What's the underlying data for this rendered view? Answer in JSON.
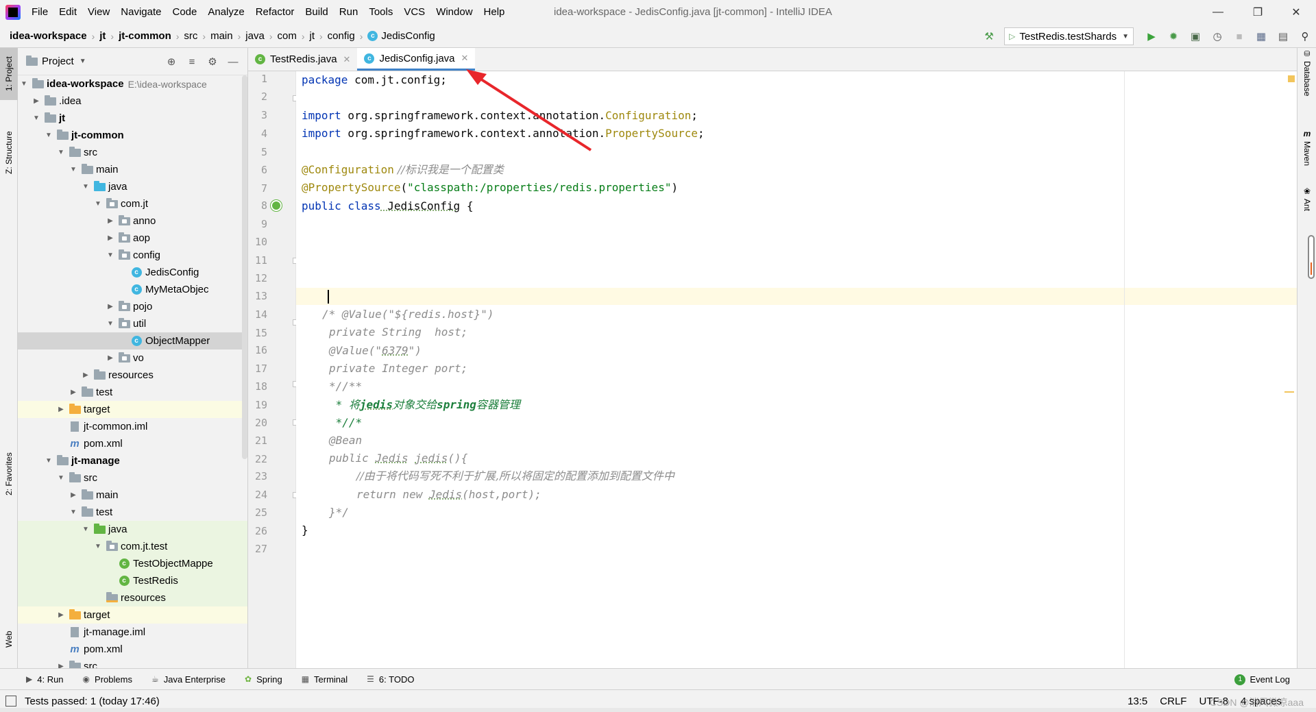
{
  "window": {
    "title": "idea-workspace - JedisConfig.java [jt-common] - IntelliJ IDEA",
    "menu": [
      "File",
      "Edit",
      "View",
      "Navigate",
      "Code",
      "Analyze",
      "Refactor",
      "Build",
      "Run",
      "Tools",
      "VCS",
      "Window",
      "Help"
    ]
  },
  "breadcrumb": [
    "idea-workspace",
    "jt",
    "jt-common",
    "src",
    "main",
    "java",
    "com",
    "jt",
    "config",
    "JedisConfig"
  ],
  "toolbar": {
    "run_config": "TestRedis.testShards",
    "icons": [
      "hammer-icon",
      "run-icon",
      "debug-icon",
      "coverage-icon",
      "profile-icon",
      "stop-icon",
      "project-structure-icon",
      "layout-icon",
      "search-icon"
    ]
  },
  "left_stripe": {
    "project": "1: Project",
    "structure": "Z: Structure",
    "favorites": "2: Favorites",
    "web": "Web"
  },
  "right_stripe": {
    "database": "Database",
    "maven": "Maven",
    "ant": "Ant"
  },
  "project_panel": {
    "title": "Project",
    "tree": [
      {
        "label": "idea-workspace",
        "path": "E:\\idea-workspace",
        "bold": true
      },
      {
        "label": ".idea"
      },
      {
        "label": "jt",
        "bold": true
      },
      {
        "label": "jt-common",
        "bold": true
      },
      {
        "label": "src"
      },
      {
        "label": "main"
      },
      {
        "label": "java"
      },
      {
        "label": "com.jt"
      },
      {
        "label": "anno"
      },
      {
        "label": "aop"
      },
      {
        "label": "config"
      },
      {
        "label": "JedisConfig"
      },
      {
        "label": "MyMetaObjec"
      },
      {
        "label": "pojo"
      },
      {
        "label": "util"
      },
      {
        "label": "ObjectMapper"
      },
      {
        "label": "vo"
      },
      {
        "label": "resources"
      },
      {
        "label": "test"
      },
      {
        "label": "target"
      },
      {
        "label": "jt-common.iml"
      },
      {
        "label": "pom.xml"
      },
      {
        "label": "jt-manage",
        "bold": true
      },
      {
        "label": "src"
      },
      {
        "label": "main"
      },
      {
        "label": "test"
      },
      {
        "label": "java"
      },
      {
        "label": "com.jt.test"
      },
      {
        "label": "TestObjectMappe"
      },
      {
        "label": "TestRedis"
      },
      {
        "label": "resources"
      },
      {
        "label": "target"
      },
      {
        "label": "jt-manage.iml"
      },
      {
        "label": "pom.xml"
      },
      {
        "label": "src"
      }
    ]
  },
  "tabs": [
    {
      "label": "TestRedis.java",
      "active": false
    },
    {
      "label": "JedisConfig.java",
      "active": true
    }
  ],
  "editor": {
    "line_numbers": [
      "1",
      "2",
      "3",
      "4",
      "5",
      "6",
      "7",
      "8",
      "9",
      "10",
      "11",
      "12",
      "13",
      "14",
      "15",
      "16",
      "17",
      "18",
      "19",
      "20",
      "21",
      "22",
      "23",
      "24",
      "25",
      "26",
      "27"
    ],
    "code": {
      "l1_kw": "package",
      "l1_rest": " com.jt.config;",
      "l3_kw": "import",
      "l3_pkg": " org.springframework.context.annotation.",
      "l3_cls": "Configuration",
      "l3_end": ";",
      "l4_kw": "import",
      "l4_pkg": " org.springframework.context.annotation.",
      "l4_cls": "PropertySource",
      "l4_end": ";",
      "l6_ann": "@Configuration",
      "l6_cmt": " //标识我是一个配置类",
      "l7_ann": "@PropertySource",
      "l7_p1": "(",
      "l7_str": "\"classpath:/properties/redis.properties\"",
      "l7_p2": ")",
      "l8_kw": "public class",
      "l8_name": " JedisConfig",
      "l8_brace": " {",
      "l14": "/* @Value(\"${redis.host}\")",
      "l15": "private String  host;",
      "l16a": "@Value(\"",
      "l16b": "6379",
      "l16c": "\")",
      "l17": "private Integer port;",
      "l18": "*//**",
      "l19a": " * 将",
      "l19b": "jedis",
      "l19c": "对象交给",
      "l19d": "spring",
      "l19e": "容器管理",
      "l20": " *//*",
      "l21": "@Bean",
      "l22a": "public ",
      "l22b": "Jedis",
      "l22c": " ",
      "l22d": "jedis",
      "l22e": "(){",
      "l23": "//由于将代码写死不利于扩展,所以将固定的配置添加到配置文件中",
      "l24a": "return new ",
      "l24b": "Jedis",
      "l24c": "(host,port);",
      "l25": "}*/",
      "l26": "}"
    }
  },
  "bottom_tabs": [
    {
      "label": "4: Run",
      "icon": "play-icon"
    },
    {
      "label": "Problems",
      "icon": "problems-icon"
    },
    {
      "label": "Java Enterprise",
      "icon": "java-enterprise-icon"
    },
    {
      "label": "Spring",
      "icon": "spring-icon"
    },
    {
      "label": "Terminal",
      "icon": "terminal-icon"
    },
    {
      "label": "6: TODO",
      "icon": "todo-icon"
    }
  ],
  "event_log": {
    "label": "Event Log",
    "badge": "1"
  },
  "status": {
    "message": "Tests passed: 1 (today 17:46)",
    "position": "13:5",
    "line_sep": "CRLF",
    "encoding": "UTF-8",
    "indent": "4 spaces",
    "watermark": "CSDN @消风微凉aaa"
  },
  "colors": {
    "keyword": "#0033b3",
    "annotation": "#9e880d",
    "string": "#067d17",
    "comment": "#8c8c8c",
    "accent": "#4083c9",
    "arrow": "#e8262b"
  }
}
